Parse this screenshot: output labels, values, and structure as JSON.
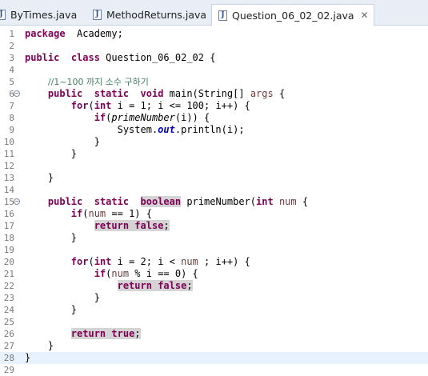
{
  "tabs": [
    {
      "label": "ByTimes.java",
      "active": false
    },
    {
      "label": "MethodReturns.java",
      "active": false
    },
    {
      "label": "Question_06_02_02.java",
      "active": true
    }
  ],
  "editor": {
    "current_line": 28,
    "lines": [
      {
        "n": "1",
        "tokens": [
          [
            "kw",
            "package"
          ],
          [
            "",
            "  Academy;"
          ]
        ]
      },
      {
        "n": "2",
        "tokens": []
      },
      {
        "n": "3",
        "tokens": [
          [
            "kw",
            "public"
          ],
          [
            "",
            "  "
          ],
          [
            "kw",
            "class"
          ],
          [
            "",
            " Question_06_02_02 {"
          ]
        ]
      },
      {
        "n": "4",
        "tokens": []
      },
      {
        "n": "5",
        "tokens": [
          [
            "",
            "    "
          ],
          [
            "cm",
            "//1~100 까지 소수 구하기"
          ]
        ]
      },
      {
        "n": "6",
        "fold": true,
        "tokens": [
          [
            "",
            "    "
          ],
          [
            "kw",
            "public"
          ],
          [
            "",
            "  "
          ],
          [
            "kw",
            "static"
          ],
          [
            "",
            "  "
          ],
          [
            "kw",
            "void"
          ],
          [
            "",
            " main(String[] "
          ],
          [
            "par",
            "args"
          ],
          [
            "",
            " {"
          ]
        ]
      },
      {
        "n": "7",
        "tokens": [
          [
            "",
            "        "
          ],
          [
            "kw",
            "for"
          ],
          [
            "",
            "("
          ],
          [
            "kw",
            "int"
          ],
          [
            "",
            " i = 1; i <= 100; i++) {"
          ]
        ]
      },
      {
        "n": "8",
        "tokens": [
          [
            "",
            "            "
          ],
          [
            "kw",
            "if"
          ],
          [
            "",
            "("
          ],
          [
            "it",
            "primeNumber"
          ],
          [
            "",
            "(i)) {"
          ]
        ]
      },
      {
        "n": "9",
        "tokens": [
          [
            "",
            "                System."
          ],
          [
            "fld",
            "out"
          ],
          [
            "",
            ".println(i);"
          ]
        ]
      },
      {
        "n": "10",
        "tokens": [
          [
            "",
            "            }"
          ]
        ]
      },
      {
        "n": "11",
        "tokens": [
          [
            "",
            "        }"
          ]
        ]
      },
      {
        "n": "12",
        "tokens": []
      },
      {
        "n": "13",
        "tokens": [
          [
            "",
            "    }"
          ]
        ]
      },
      {
        "n": "14",
        "tokens": []
      },
      {
        "n": "15",
        "fold": true,
        "tokens": [
          [
            "",
            "    "
          ],
          [
            "kw",
            "public"
          ],
          [
            "",
            "  "
          ],
          [
            "kw",
            "static"
          ],
          [
            "",
            "  "
          ],
          [
            "kwhl",
            "boolean"
          ],
          [
            "",
            " primeNumber("
          ],
          [
            "kw",
            "int"
          ],
          [
            "",
            " "
          ],
          [
            "par",
            "num"
          ],
          [
            "",
            " {"
          ]
        ]
      },
      {
        "n": "16",
        "tokens": [
          [
            "",
            "        "
          ],
          [
            "kw",
            "if"
          ],
          [
            "",
            "("
          ],
          [
            "par",
            "num"
          ],
          [
            "",
            " == 1) {"
          ]
        ]
      },
      {
        "n": "17",
        "tokens": [
          [
            "",
            "            "
          ],
          [
            "kwhl",
            "return"
          ],
          [
            "hl",
            " "
          ],
          [
            "kwhl",
            "false"
          ],
          [
            "hl",
            ";"
          ]
        ]
      },
      {
        "n": "18",
        "tokens": [
          [
            "",
            "        }"
          ]
        ]
      },
      {
        "n": "19",
        "tokens": []
      },
      {
        "n": "20",
        "tokens": [
          [
            "",
            "        "
          ],
          [
            "kw",
            "for"
          ],
          [
            "",
            "("
          ],
          [
            "kw",
            "int"
          ],
          [
            "",
            " i = 2; i < "
          ],
          [
            "par",
            "num"
          ],
          [
            "",
            " ; i++) {"
          ]
        ]
      },
      {
        "n": "21",
        "tokens": [
          [
            "",
            "            "
          ],
          [
            "kw",
            "if"
          ],
          [
            "",
            "("
          ],
          [
            "par",
            "num"
          ],
          [
            "",
            " % i == 0) {"
          ]
        ]
      },
      {
        "n": "22",
        "tokens": [
          [
            "",
            "                "
          ],
          [
            "kwhl",
            "return"
          ],
          [
            "hl",
            " "
          ],
          [
            "kwhl",
            "false"
          ],
          [
            "hl",
            ";"
          ]
        ]
      },
      {
        "n": "23",
        "tokens": [
          [
            "",
            "            }"
          ]
        ]
      },
      {
        "n": "24",
        "tokens": [
          [
            "",
            "        }"
          ]
        ]
      },
      {
        "n": "25",
        "tokens": []
      },
      {
        "n": "26",
        "tokens": [
          [
            "",
            "        "
          ],
          [
            "kwhl",
            "return"
          ],
          [
            "hl",
            " "
          ],
          [
            "kwhl",
            "true"
          ],
          [
            "hl",
            ";"
          ]
        ]
      },
      {
        "n": "27",
        "tokens": [
          [
            "",
            "    }"
          ]
        ]
      },
      {
        "n": "28",
        "tokens": [
          [
            "",
            "}"
          ]
        ]
      },
      {
        "n": "29",
        "tokens": []
      }
    ]
  }
}
